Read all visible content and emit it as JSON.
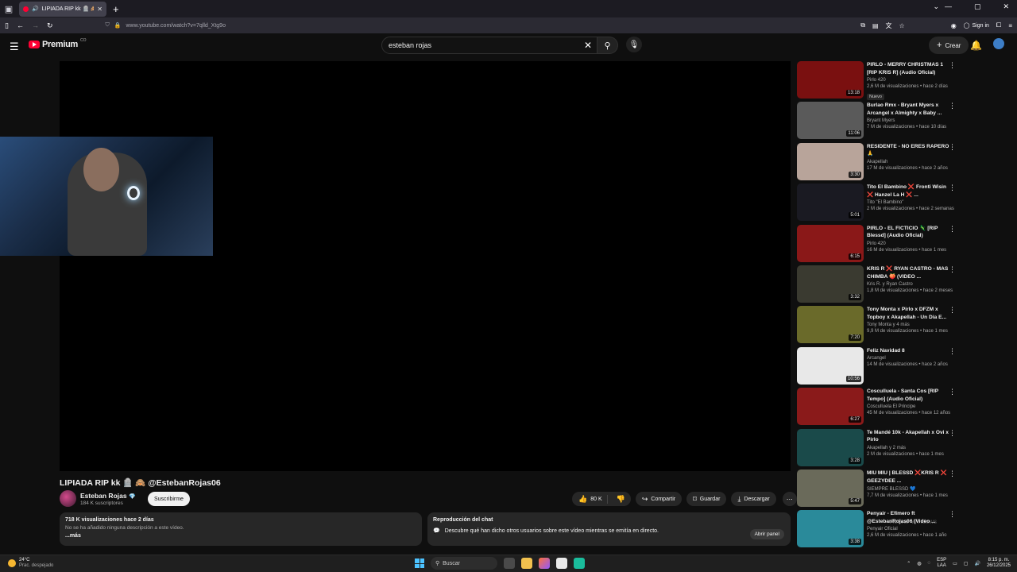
{
  "browser": {
    "tab_title": "LIPIADA RIP kk 🪦 🙈 @Est",
    "url_host": "www.youtube.com",
    "url_path": "/watch?v=7qlld_Xtg9o",
    "sign_in": "Sign in"
  },
  "header": {
    "logo_word": "Premium",
    "logo_country": "CO",
    "search_value": "esteban rojas",
    "create_label": "Crear"
  },
  "video": {
    "title": "LIPIADA RIP kk 🪦 🙈 @EstebanRojas06",
    "channel": "Esteban Rojas",
    "subscribers": "184 K suscriptores",
    "subscribe_label": "Suscribirme",
    "likes": "80 K",
    "share_label": "Compartir",
    "save_label": "Guardar",
    "download_label": "Descargar"
  },
  "description": {
    "meta": "718 K visualizaciones  hace 2 días",
    "text": "No se ha añadido ninguna descripción a este vídeo.",
    "more": "...más"
  },
  "chat": {
    "heading": "Reproducción del chat",
    "text": "Descubre qué han dicho otros usuarios sobre este vídeo mientras se emitía en directo.",
    "open_label": "Abrir panel"
  },
  "recommendations": [
    {
      "title": "PIRLO - MERRY CHRISTMAS 1 [RIP KRIS R] (Audio Oficial)",
      "channel": "Pirlo 420",
      "stats": "2,6 M de visualizaciones • hace 2 días",
      "duration": "13:18",
      "badge": "Nuevo",
      "color": "#7a1010"
    },
    {
      "title": "Burlao Rmx - Bryant Myers x Arcangel x Almighty x Baby ...",
      "channel": "Bryant Myers",
      "stats": "7 M de visualizaciones • hace 10 días",
      "duration": "11:06",
      "badge": "",
      "color": "#5a5a5a"
    },
    {
      "title": "RESIDENTE - NO ERES RAPERO 🙏",
      "channel": "Akapellah",
      "stats": "17 M de visualizaciones • hace 2 años",
      "duration": "3:30",
      "badge": "",
      "color": "#b8a49a"
    },
    {
      "title": "Tito El Bambino ❌ Fronti Wisin ❌ Hanzel La H ❌ ...",
      "channel": "Tito \"El Bambino\"",
      "stats": "2 M de visualizaciones • hace 2 semanas",
      "duration": "5:01",
      "badge": "",
      "color": "#1a1a22"
    },
    {
      "title": "PIRLO - EL FICTICIO 🦎 [RIP Blessd] (Audio Oficial)",
      "channel": "Pirlo 420",
      "stats": "16 M de visualizaciones • hace 1 mes",
      "duration": "6:15",
      "badge": "",
      "color": "#8a1818"
    },
    {
      "title": "KRIS R ❌ RYAN CASTRO - MAS CHIMBA 🍑 (VIDEO ...",
      "channel": "Kris R. y Ryan Castro",
      "stats": "1,8 M de visualizaciones • hace 2 meses",
      "duration": "3:32",
      "badge": "",
      "color": "#3a3a30"
    },
    {
      "title": "Tony Monta x Pirlo x DFZM x Topboy x Akapellah - Un Dia E...",
      "channel": "Tony Monta y 4 más",
      "stats": "9,9 M de visualizaciones • hace 1 mes",
      "duration": "7:20",
      "badge": "",
      "color": "#6a6a2a"
    },
    {
      "title": "Feliz Navidad 8",
      "channel": "Arcangel",
      "stats": "14 M de visualizaciones • hace 2 años",
      "duration": "10:56",
      "badge": "",
      "color": "#e8e8e8"
    },
    {
      "title": "Cosculluela - Santa Cos [RIP Tempo] (Audio Oficial)",
      "channel": "Cosculluela El Principe",
      "stats": "45 M de visualizaciones • hace 12 años",
      "duration": "6:27",
      "badge": "",
      "color": "#8a1a1a"
    },
    {
      "title": "Te Mandé 10k - Akapellah x Ovi x Pirlo",
      "channel": "Akapellah y 2 más",
      "stats": "2 M de visualizaciones • hace 1 mes",
      "duration": "3:28",
      "badge": "",
      "color": "#1a4a4a"
    },
    {
      "title": "MIU MIU | BLESSD ❌KRIS R ❌ GEEZYDEE ...",
      "channel": "SIEMPRE BLESSD 💙",
      "stats": "7,7 M de visualizaciones • hace 1 mes",
      "duration": "5:47",
      "badge": "",
      "color": "#6a6a5a"
    },
    {
      "title": "Penyair - Efímero ft @EstebanRojas06 (Video ...",
      "channel": "Penyair Oficial",
      "stats": "2,6 M de visualizaciones • hace 1 año",
      "duration": "3:38",
      "badge": "",
      "color": "#2a8a9a"
    }
  ],
  "watermark": "Activar Windows",
  "taskbar": {
    "temp": "24°C",
    "condition": "Prac. despejado",
    "search": "Buscar",
    "lang1": "ESP",
    "lang2": "LAA",
    "time": "8:15 p. m.",
    "date": "26/12/2025"
  }
}
